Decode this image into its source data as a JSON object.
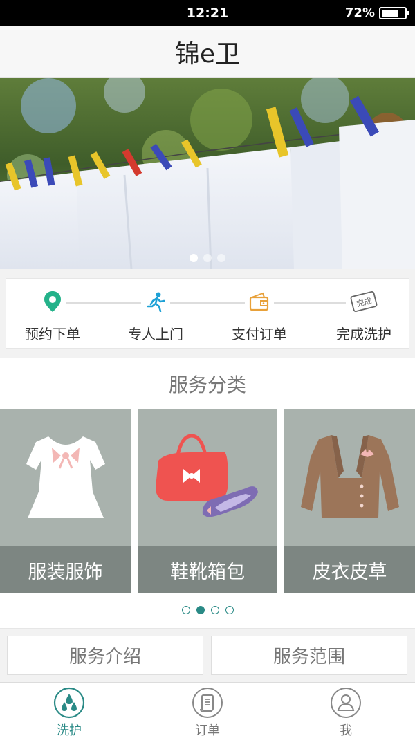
{
  "status_bar": {
    "time": "12:21",
    "battery": "72%",
    "battery_level": 0.72
  },
  "header": {
    "title": "锦e卫"
  },
  "banner": {
    "dots": 3,
    "active_dot": 0
  },
  "steps": [
    {
      "label": "预约下单",
      "icon": "location-pin-icon"
    },
    {
      "label": "专人上门",
      "icon": "running-person-icon"
    },
    {
      "label": "支付订单",
      "icon": "wallet-icon"
    },
    {
      "label": "完成洗护",
      "icon": "completed-stamp-icon",
      "stamp_text": "完成"
    }
  ],
  "service_category": {
    "title": "服务分类",
    "cards": [
      {
        "label": "服装服饰",
        "icon": "blouse-icon"
      },
      {
        "label": "鞋靴箱包",
        "icon": "handbag-shoes-icon"
      },
      {
        "label": "皮衣皮草",
        "icon": "leather-jacket-icon"
      }
    ],
    "dots": 4,
    "active_dot": 1
  },
  "info_buttons": {
    "intro": "服务介绍",
    "scope": "服务范围"
  },
  "tab_bar": {
    "tabs": [
      {
        "label": "洗护",
        "icon": "water-drops-icon",
        "active": true
      },
      {
        "label": "订单",
        "icon": "order-scroll-icon",
        "active": false
      },
      {
        "label": "我",
        "icon": "user-icon",
        "active": false
      }
    ]
  },
  "colors": {
    "accent": "#2a8a86",
    "card_bg": "#a9b2ad",
    "card_label_bg": "#7d8682"
  }
}
